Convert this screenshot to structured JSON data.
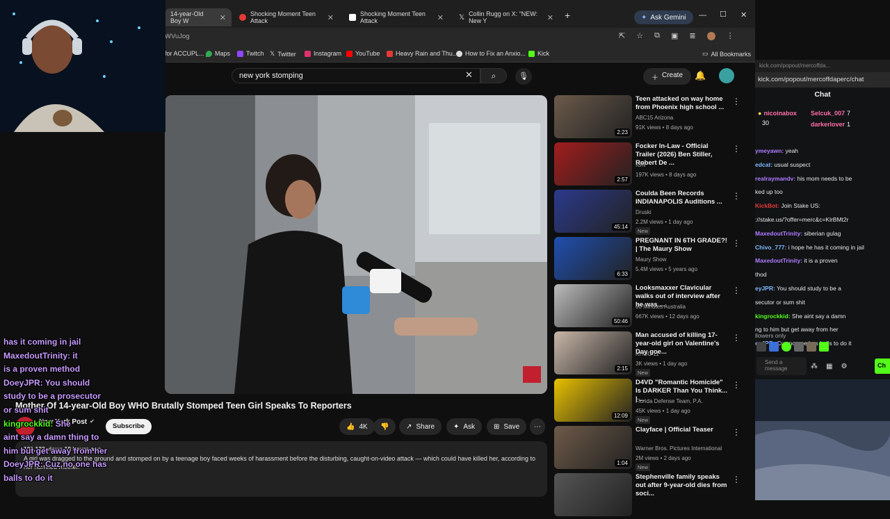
{
  "browser": {
    "tabs": [
      {
        "label": "14-year-Old Boy W",
        "active": true,
        "icon_color": "#ff0000"
      },
      {
        "label": "Shocking Moment Teen Attack",
        "active": false,
        "icon_color": "#e53935"
      },
      {
        "label": "Shocking Moment Teen Attack",
        "active": false,
        "icon_color": "#ffffff"
      },
      {
        "label": "Collin Rugg on X: \"NEW: New Y",
        "active": false,
        "icon_color": "#ffffff"
      }
    ],
    "new_tab_label": "+",
    "gemini_label": "Ask Gemini",
    "url": "WVuJog",
    "bookmarks": [
      {
        "label": "for ACCUPL...",
        "color": "#888"
      },
      {
        "label": "Maps",
        "color": "#34a853"
      },
      {
        "label": "Twitch",
        "color": "#9146ff"
      },
      {
        "label": "Twitter",
        "color": "#ffffff"
      },
      {
        "label": "Instagram",
        "color": "#e1306c"
      },
      {
        "label": "YouTube",
        "color": "#ff0000"
      },
      {
        "label": "Heavy Rain and Thu...",
        "color": "#e53935"
      },
      {
        "label": "How to Fix an Anxio...",
        "color": "#dddddd"
      },
      {
        "label": "Kick",
        "color": "#53fc18"
      }
    ],
    "all_bookmarks": "All Bookmarks"
  },
  "youtube": {
    "search_value": "new york stomping",
    "create_label": "Create",
    "video_title": "Mother Of 14-year-Old Boy WHO Brutally Stomped Teen Girl Speaks To Reporters",
    "channel": "New York Post",
    "subscribe_label": "Subscribe",
    "likes": "4K",
    "share_label": "Share",
    "ask_label": "Ask",
    "save_label": "Save",
    "views_time": "101,133 views  19 hours ago",
    "description": "A girl was dragged to the ground and stomped on by a teenage boy faced weeks of harassment before the disturbing, caught-on-video attack — which could have killed her, according to her horrified mother.",
    "recommendations": [
      {
        "title": "Teen attacked on way home from Phoenix high school ...",
        "channel": "ABC15 Arizona",
        "meta": "91K views • 8 days ago",
        "duration": "2:23",
        "badge": "",
        "color": "#6b5a4a"
      },
      {
        "title": "Focker In-Law - Official Trailer (2026) Ben Stiller, Robert De ...",
        "channel": "IGN",
        "meta": "197K views • 8 days ago",
        "duration": "2:57",
        "badge": "",
        "color": "#a31d1d"
      },
      {
        "title": "Coulda Been Records INDIANAPOLIS Auditions ...",
        "channel": "Druski",
        "meta": "2.2M views • 1 day ago",
        "duration": "45:14",
        "badge": "New",
        "color": "#2b3a8c"
      },
      {
        "title": "PREGNANT IN 6TH GRADE?! | The Maury Show",
        "channel": "Maury Show",
        "meta": "5.4M views • 5 years ago",
        "duration": "6:33",
        "badge": "",
        "color": "#1f4fb0"
      },
      {
        "title": "Looksmaxxer Clavicular walks out of interview after he was ...",
        "channel": "60 Minutes Australia",
        "meta": "667K views • 12 days ago",
        "duration": "50:46",
        "badge": "",
        "color": "#bcbcbc"
      },
      {
        "title": "Man accused of killing 17-year-old girl on Valentine's Day goe...",
        "channel": "KHOU 11",
        "meta": "3K views • 1 day ago",
        "duration": "2:15",
        "badge": "New",
        "color": "#c9b7a8"
      },
      {
        "title": "D4VD \"Romantic Homicide\" Is DARKER Than You Think... | ...",
        "channel": "Florida Defense Team, P.A.",
        "meta": "45K views • 1 day ago",
        "duration": "12:09",
        "badge": "New",
        "color": "#e8c000"
      },
      {
        "title": "Clayface | Official Teaser",
        "channel": "Warner Bros. Pictures International",
        "meta": "2M views • 2 days ago",
        "duration": "1:04",
        "badge": "New",
        "color": "#6e5a48"
      },
      {
        "title": "Stephenville family speaks out after 9-year-old dies from soci...",
        "channel": "",
        "meta": "",
        "duration": "",
        "badge": "",
        "color": "#555"
      }
    ]
  },
  "chat": {
    "url": "kick.com/popout/mercoffdaperc/chat",
    "url_faded": "kick.com/popout/mercoffda...",
    "header": "Chat",
    "leaders": [
      {
        "name": "nicoinabox",
        "count": "30"
      },
      {
        "name": "Selcuk_007",
        "count": "7"
      },
      {
        "name": "darkerlover",
        "count": "1"
      }
    ],
    "messages": [
      {
        "user": "ymeyawn:",
        "text": " yeah",
        "color": "#b07cff"
      },
      {
        "user": "edcat:",
        "text": " usual suspect",
        "color": "#7fb8ff"
      },
      {
        "user": "realraymandv:",
        "text": " his mom needs to be",
        "color": "#b07cff"
      },
      {
        "user": "",
        "text": "ked up too",
        "color": "#e8e8e8"
      },
      {
        "user": "KickBot:",
        "text": " Join Stake US:",
        "color": "#e53935"
      },
      {
        "user": "",
        "text": "://stake.us/?offer=merc&c=KlrBMt2r",
        "color": "#e8e8e8"
      },
      {
        "user": "MaxedoutTrinity:",
        "text": " siberian gulag",
        "color": "#b07cff"
      },
      {
        "user": "Chivo_777:",
        "text": " i hope he has it coming in jail",
        "color": "#7fb8ff"
      },
      {
        "user": "MaxedoutTrinity:",
        "text": " it is a proven",
        "color": "#b07cff"
      },
      {
        "user": "",
        "text": "thod",
        "color": "#e8e8e8"
      },
      {
        "user": "eyJPR:",
        "text": " You should study to be a",
        "color": "#7fb8ff"
      },
      {
        "user": "",
        "text": "secutor or sum shit",
        "color": "#e8e8e8"
      },
      {
        "user": "kingrockkid:",
        "text": " She aint say a damn",
        "color": "#53fc18"
      },
      {
        "user": "",
        "text": "ng to him but get away from her",
        "color": "#e8e8e8"
      },
      {
        "user": "eyJPR:",
        "text": " Cuz no one has balls to do it",
        "color": "#7fb8ff"
      }
    ],
    "followers_only": "llowers only",
    "send_placeholder": "Send a message",
    "chat_button": "Ch"
  },
  "overlay": {
    "lines": [
      {
        "user": "",
        "text": "has it coming in jail",
        "color": "#c89bff"
      },
      {
        "user": "MaxedoutTrinity:",
        "text": " it",
        "color": "#c89bff"
      },
      {
        "user": "",
        "text": "is a proven method",
        "color": "#c89bff"
      },
      {
        "user": "DoeyJPR:",
        "text": " You should",
        "color": "#c89bff"
      },
      {
        "user": "",
        "text": "study to be a prosecutor",
        "color": "#c89bff"
      },
      {
        "user": "",
        "text": "or sum shit",
        "color": "#c89bff"
      },
      {
        "user": "kingrockkid:",
        "text": " She",
        "color": "#53fc18"
      },
      {
        "user": "",
        "text": "aint say a damn thing to",
        "color": "#c89bff"
      },
      {
        "user": "",
        "text": "him but get away from her",
        "color": "#c89bff"
      },
      {
        "user": "DoeyJPR:",
        "text": " Cuz no one has",
        "color": "#c89bff"
      },
      {
        "user": "",
        "text": "balls to do it",
        "color": "#c89bff"
      }
    ]
  },
  "colors": {
    "yt_bg": "#0f0f0f",
    "kick_green": "#53fc18",
    "chat_bg": "#111315"
  }
}
